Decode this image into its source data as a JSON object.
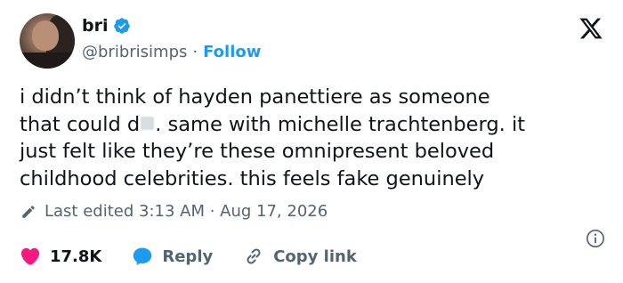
{
  "user": {
    "name": "bri",
    "handle": "@bribrisimps",
    "separator": "·",
    "follow_label": "Follow"
  },
  "tweet": {
    "text_before": "i didn’t think of hayden panettiere as someone\nthat could d",
    "text_after": ". same with michelle trachtenberg. it\njust felt like they’re these omnipresent beloved\nchildhood celebrities. this feels fake genuinely"
  },
  "meta": {
    "edited_label": "Last edited 3:13 AM · Aug 17, 2026"
  },
  "actions": {
    "likes": "17.8K",
    "reply_label": "Reply",
    "copy_label": "Copy link"
  },
  "colors": {
    "accent": "#1d9bf0",
    "like": "#f91880",
    "muted": "#536471",
    "text": "#0f1419"
  },
  "icons": [
    "verified-badge-icon",
    "x-logo-icon",
    "pencil-icon",
    "info-icon",
    "heart-icon",
    "reply-bubble-icon",
    "link-icon"
  ]
}
